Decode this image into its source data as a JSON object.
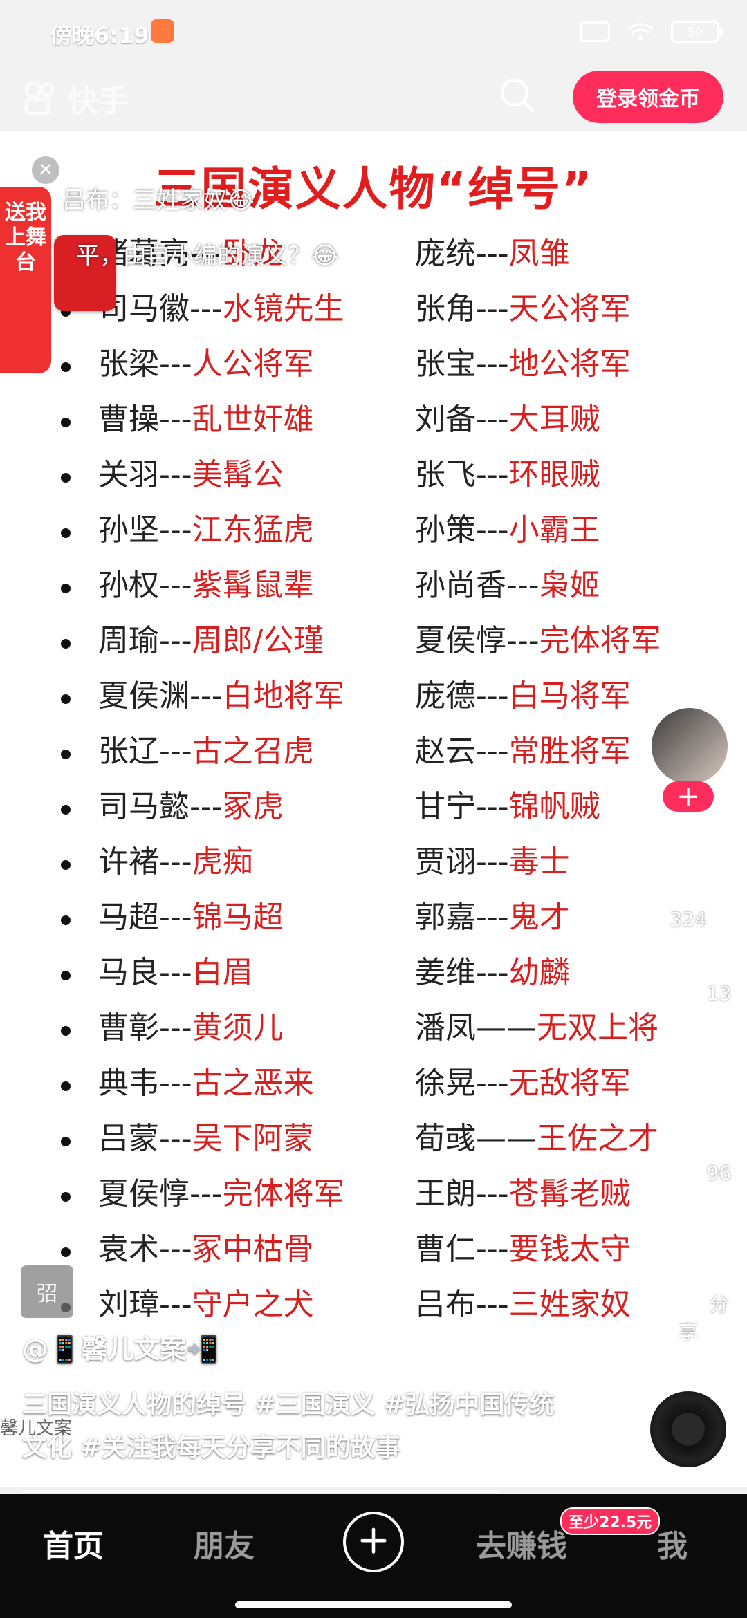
{
  "status_bar": {
    "time": "傍晚6:19",
    "battery": "50"
  },
  "top_bar": {
    "app_name": "快手",
    "login_button": "登录领金币"
  },
  "video": {
    "title": "三国演义人物“绰号”",
    "rows": [
      {
        "left": {
          "name": "诸葛亮",
          "sep": "---",
          "title": "卧龙"
        },
        "right": {
          "name": "庞统",
          "sep": "---",
          "title": "凤雏"
        }
      },
      {
        "left": {
          "name": "司马徽",
          "sep": "---",
          "title": "水镜先生"
        },
        "right": {
          "name": "张角",
          "sep": "---",
          "title": "天公将军"
        }
      },
      {
        "left": {
          "name": "张梁",
          "sep": "---",
          "title": "人公将军"
        },
        "right": {
          "name": "张宝",
          "sep": "---",
          "title": "地公将军"
        }
      },
      {
        "left": {
          "name": "曹操",
          "sep": "---",
          "title": "乱世奸雄"
        },
        "right": {
          "name": "刘备",
          "sep": "---",
          "title": "大耳贼"
        }
      },
      {
        "left": {
          "name": "关羽",
          "sep": "---",
          "title": "美髯公"
        },
        "right": {
          "name": "张飞",
          "sep": "---",
          "title": "环眼贼"
        }
      },
      {
        "left": {
          "name": "孙坚",
          "sep": "---",
          "title": "江东猛虎"
        },
        "right": {
          "name": "孙策",
          "sep": "---",
          "title": "小霸王"
        }
      },
      {
        "left": {
          "name": "孙权",
          "sep": "---",
          "title": "紫髯鼠辈"
        },
        "right": {
          "name": "孙尚香",
          "sep": "---",
          "title": "枭姬"
        }
      },
      {
        "left": {
          "name": "周瑜",
          "sep": "---",
          "title": "周郎/公瑾"
        },
        "right": {
          "name": "夏侯惇",
          "sep": "---",
          "title": "完体将军"
        }
      },
      {
        "left": {
          "name": "夏侯渊",
          "sep": "---",
          "title": "白地将军"
        },
        "right": {
          "name": "庞德",
          "sep": "---",
          "title": "白马将军"
        }
      },
      {
        "left": {
          "name": "张辽",
          "sep": "---",
          "title": "古之召虎"
        },
        "right": {
          "name": "赵云",
          "sep": "---",
          "title": "常胜将军"
        }
      },
      {
        "left": {
          "name": "司马懿",
          "sep": "---",
          "title": "冢虎"
        },
        "right": {
          "name": "甘宁",
          "sep": "---",
          "title": "锦帆贼"
        }
      },
      {
        "left": {
          "name": "许褚",
          "sep": "---",
          "title": "虎痴"
        },
        "right": {
          "name": "贾诩",
          "sep": "---",
          "title": "毒士"
        }
      },
      {
        "left": {
          "name": "马超",
          "sep": "---",
          "title": "锦马超"
        },
        "right": {
          "name": "郭嘉",
          "sep": "---",
          "title": "鬼才"
        }
      },
      {
        "left": {
          "name": "马良",
          "sep": "---",
          "title": "白眉"
        },
        "right": {
          "name": "姜维",
          "sep": "---",
          "title": "幼麟"
        }
      },
      {
        "left": {
          "name": "曹彰",
          "sep": "---",
          "title": "黄须儿"
        },
        "right": {
          "name": "潘凤",
          "sep": "——",
          "title": "无双上将"
        }
      },
      {
        "left": {
          "name": "典韦",
          "sep": "---",
          "title": "古之恶来"
        },
        "right": {
          "name": "徐晃",
          "sep": "---",
          "title": "无敌将军"
        }
      },
      {
        "left": {
          "name": "吕蒙",
          "sep": "---",
          "title": "吴下阿蒙"
        },
        "right": {
          "name": "荀彧",
          "sep": "——",
          "title": "王佐之才"
        }
      },
      {
        "left": {
          "name": "夏侯惇",
          "sep": "---",
          "title": "完体将军"
        },
        "right": {
          "name": "王朗",
          "sep": "---",
          "title": "苍髯老贼"
        }
      },
      {
        "left": {
          "name": "袁术",
          "sep": "---",
          "title": "冢中枯骨"
        },
        "right": {
          "name": "曹仁",
          "sep": "---",
          "title": "要钱太守"
        }
      },
      {
        "left": {
          "name": "刘璋",
          "sep": "---",
          "title": "守户之犬"
        },
        "right": {
          "name": "吕布",
          "sep": "---",
          "title": "三姓家奴"
        }
      }
    ]
  },
  "overlays": {
    "redpack_label": "送我上舞台",
    "danmu_1": "吕布：三姓家奴😂",
    "danmu_2": "平，由自小编的演义？😂"
  },
  "right_rail": {
    "like_count": "324",
    "comment_count": "13",
    "collect_count": "96",
    "share_label": "分享"
  },
  "caption": {
    "corner_badge": "弨",
    "author": "@📱馨儿文案📲",
    "text": "三国演义人物的绰号 #三国演义 #弘扬中国传统文化 #关注我每天分享不同的故事",
    "bg_label": "馨儿文案"
  },
  "bottom_nav": {
    "home": "首页",
    "friends": "朋友",
    "earn": "去赚钱",
    "earn_badge": "至少22.5元",
    "me": "我"
  }
}
